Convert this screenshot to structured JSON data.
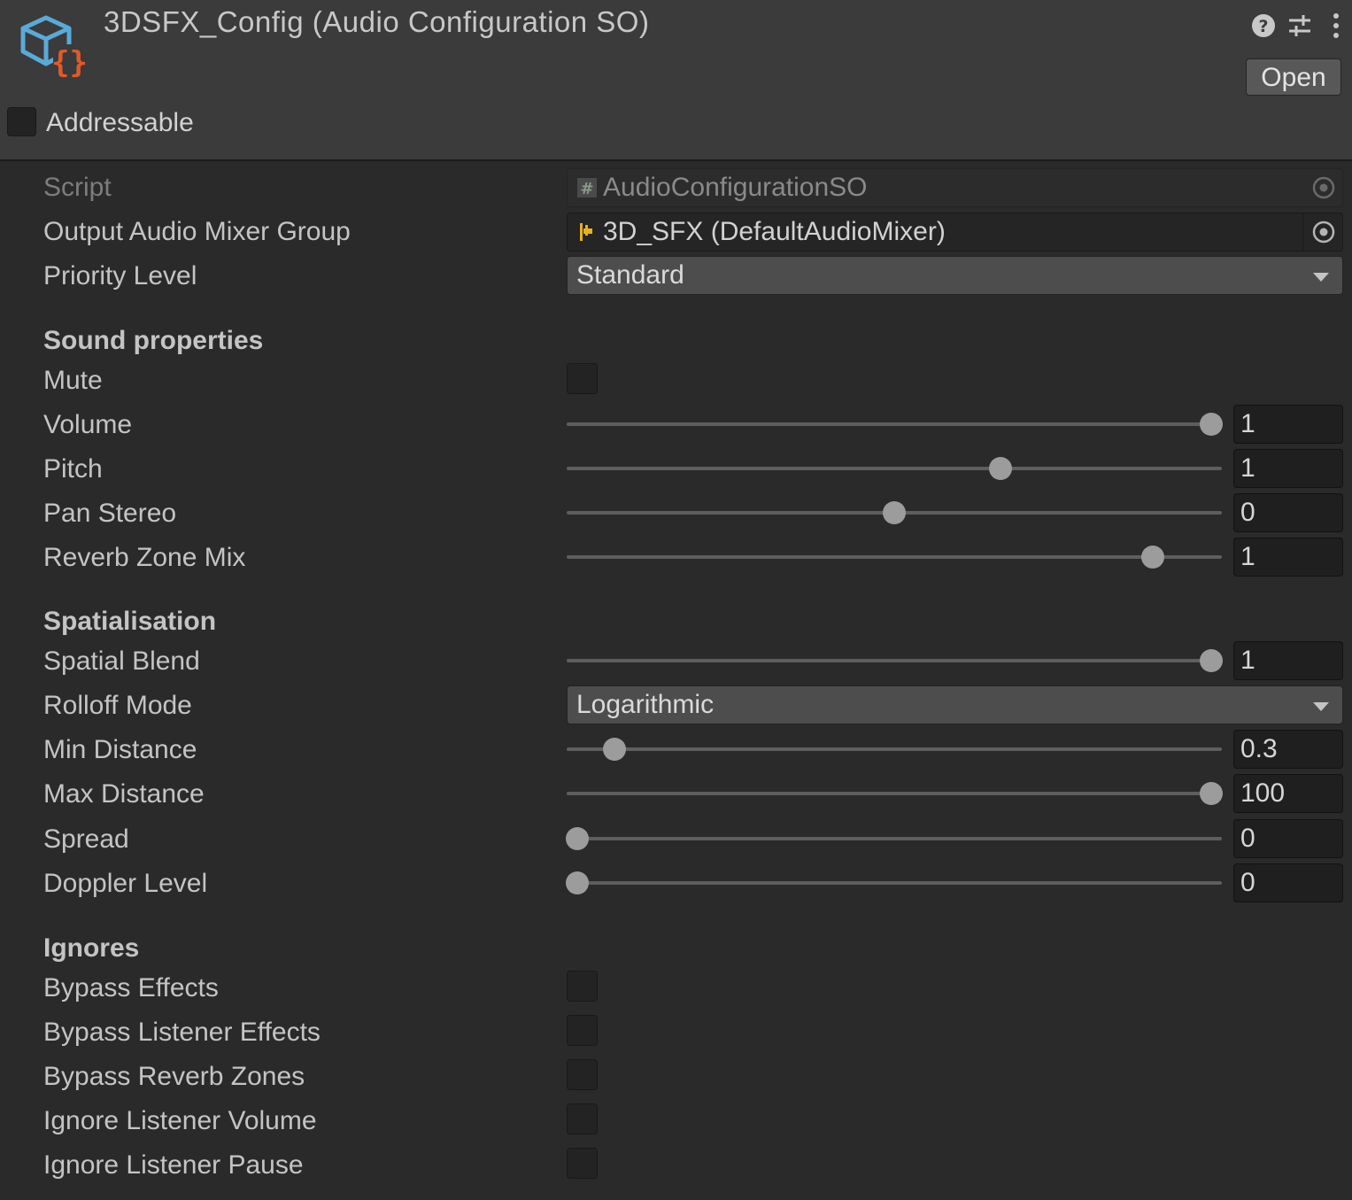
{
  "header": {
    "title": "3DSFX_Config (Audio Configuration SO)",
    "open_label": "Open",
    "icons": [
      "scriptable-object-icon",
      "help-icon",
      "preset-sliders-icon",
      "more-options-icon"
    ],
    "addressable_label": "Addressable",
    "addressable_checked": false
  },
  "fields": {
    "script": {
      "label": "Script",
      "value": "AudioConfigurationSO"
    },
    "mixer_group": {
      "label": "Output Audio Mixer Group",
      "value": "3D_SFX (DefaultAudioMixer)"
    },
    "priority": {
      "label": "Priority Level",
      "value": "Standard"
    }
  },
  "sound": {
    "header": "Sound properties",
    "mute": {
      "label": "Mute",
      "checked": false
    },
    "volume": {
      "label": "Volume",
      "value": "1",
      "fraction": 0.984
    },
    "pitch": {
      "label": "Pitch",
      "value": "1",
      "fraction": 0.662
    },
    "pan": {
      "label": "Pan Stereo",
      "value": "0",
      "fraction": 0.5
    },
    "reverb": {
      "label": "Reverb Zone Mix",
      "value": "1",
      "fraction": 0.894
    }
  },
  "spatial": {
    "header": "Spatialisation",
    "blend": {
      "label": "Spatial Blend",
      "value": "1",
      "fraction": 0.984
    },
    "rolloff": {
      "label": "Rolloff Mode",
      "value": "Logarithmic"
    },
    "min": {
      "label": "Min Distance",
      "value": "0.3",
      "fraction": 0.073
    },
    "max": {
      "label": "Max Distance",
      "value": "100",
      "fraction": 0.984
    },
    "spread": {
      "label": "Spread",
      "value": "0",
      "fraction": 0.016
    },
    "doppler": {
      "label": "Doppler Level",
      "value": "0",
      "fraction": 0.016
    }
  },
  "ignores": {
    "header": "Ignores",
    "bypass_effects": {
      "label": "Bypass Effects",
      "checked": false
    },
    "bypass_listener": {
      "label": "Bypass Listener Effects",
      "checked": false
    },
    "bypass_reverb": {
      "label": "Bypass Reverb Zones",
      "checked": false
    },
    "ignore_volume": {
      "label": "Ignore Listener Volume",
      "checked": false
    },
    "ignore_pause": {
      "label": "Ignore Listener Pause",
      "checked": false
    }
  },
  "colors": {
    "background": "#2a2a2a",
    "header_bg": "#3b3b3b",
    "icon_cube": "#5aaad8",
    "icon_braces": "#e05a2b",
    "mixer_icon": "#e8b020"
  }
}
